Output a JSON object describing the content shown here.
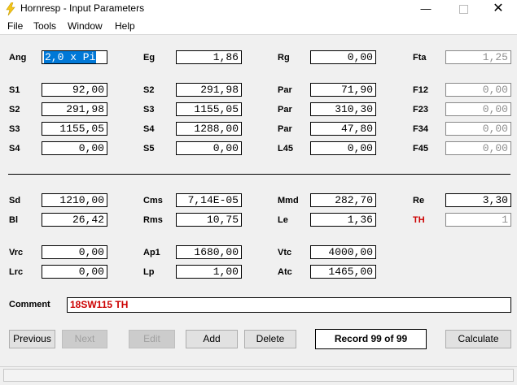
{
  "window": {
    "title": "Hornresp - Input Parameters"
  },
  "menu": [
    "File",
    "Tools",
    "Window",
    "Help"
  ],
  "rows1": [
    {
      "cells": [
        {
          "label": "Ang",
          "value": "2,0 x Pi",
          "selected": true
        },
        {
          "label": "Eg",
          "value": "1,86"
        },
        {
          "label": "Rg",
          "value": "0,00"
        },
        {
          "label": "Fta",
          "value": "1,25",
          "disabled": true
        }
      ]
    },
    {
      "cells": [
        {
          "label": "S1",
          "value": "92,00"
        },
        {
          "label": "S2",
          "value": "291,98"
        },
        {
          "label": "Par",
          "value": "71,90"
        },
        {
          "label": "F12",
          "value": "0,00",
          "disabled": true
        }
      ]
    },
    {
      "cells": [
        {
          "label": "S2",
          "value": "291,98"
        },
        {
          "label": "S3",
          "value": "1155,05"
        },
        {
          "label": "Par",
          "value": "310,30"
        },
        {
          "label": "F23",
          "value": "0,00",
          "disabled": true
        }
      ]
    },
    {
      "cells": [
        {
          "label": "S3",
          "value": "1155,05"
        },
        {
          "label": "S4",
          "value": "1288,00"
        },
        {
          "label": "Par",
          "value": "47,80"
        },
        {
          "label": "F34",
          "value": "0,00",
          "disabled": true
        }
      ]
    },
    {
      "cells": [
        {
          "label": "S4",
          "value": "0,00"
        },
        {
          "label": "S5",
          "value": "0,00"
        },
        {
          "label": "L45",
          "value": "0,00"
        },
        {
          "label": "F45",
          "value": "0,00",
          "disabled": true
        }
      ]
    }
  ],
  "rows2": [
    {
      "cells": [
        {
          "label": "Sd",
          "value": "1210,00"
        },
        {
          "label": "Cms",
          "value": "7,14E-05"
        },
        {
          "label": "Mmd",
          "value": "282,70"
        },
        {
          "label": "Re",
          "value": "3,30"
        }
      ]
    },
    {
      "cells": [
        {
          "label": "Bl",
          "value": "26,42"
        },
        {
          "label": "Rms",
          "value": "10,75"
        },
        {
          "label": "Le",
          "value": "1,36"
        },
        {
          "label": "TH",
          "value": "1",
          "red": true,
          "disabled": true
        }
      ]
    },
    {
      "cells": [
        {
          "label": "Vrc",
          "value": "0,00"
        },
        {
          "label": "Ap1",
          "value": "1680,00"
        },
        {
          "label": "Vtc",
          "value": "4000,00"
        }
      ]
    },
    {
      "cells": [
        {
          "label": "Lrc",
          "value": "0,00"
        },
        {
          "label": "Lp",
          "value": "1,00"
        },
        {
          "label": "Atc",
          "value": "1465,00"
        }
      ]
    }
  ],
  "comment": {
    "label": "Comment",
    "value": "18SW115 TH"
  },
  "buttons": {
    "previous": "Previous",
    "next": "Next",
    "edit": "Edit",
    "add": "Add",
    "delete": "Delete",
    "record": "Record 99 of 99",
    "calculate": "Calculate"
  },
  "colors": {
    "accent": "#0078d7",
    "red": "#cc0000",
    "title_icon": "#f5c518"
  }
}
